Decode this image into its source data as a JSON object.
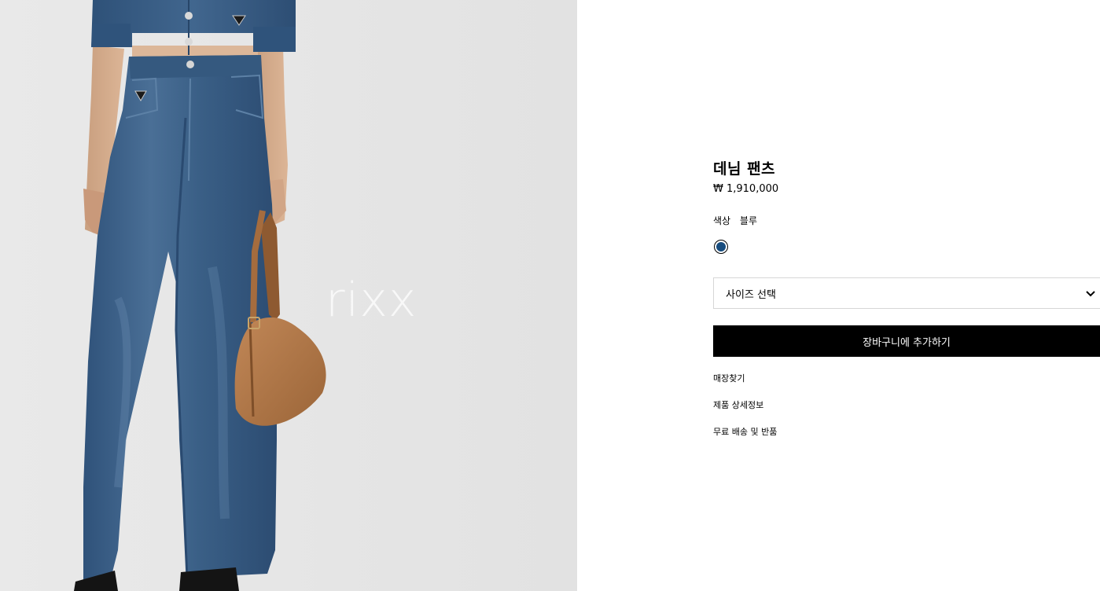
{
  "image": {
    "watermark": "rixx",
    "background_color": "#e6e6e6",
    "denim_color": "#3a5f86",
    "bag_color": "#b07746"
  },
  "product": {
    "title": "데님 팬츠",
    "price": "₩ 1,910,000",
    "color_label": "색상",
    "color_value": "블루",
    "swatch_color": "#174c7e",
    "size_placeholder": "사이즈 선택",
    "add_to_cart_label": "장바구니에 추가하기"
  },
  "links": {
    "store": "매장찾기",
    "details": "제품 상세정보",
    "shipping": "무료 배송 및 반품"
  }
}
